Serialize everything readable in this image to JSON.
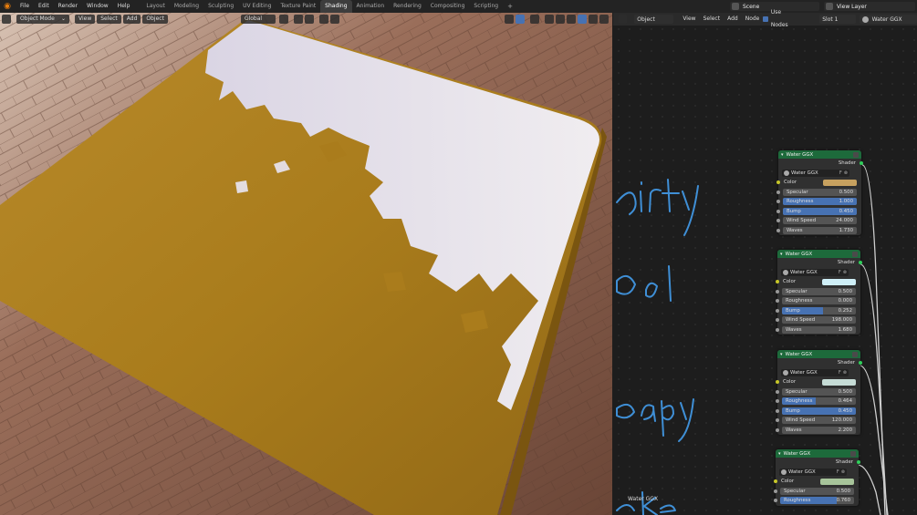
{
  "topbar": {
    "menus": [
      "File",
      "Edit",
      "Render",
      "Window",
      "Help"
    ],
    "workspaces": [
      {
        "label": "Layout",
        "active": false
      },
      {
        "label": "Modeling",
        "active": false
      },
      {
        "label": "Sculpting",
        "active": false
      },
      {
        "label": "UV Editing",
        "active": false
      },
      {
        "label": "Texture Paint",
        "active": false
      },
      {
        "label": "Shading",
        "active": true
      },
      {
        "label": "Animation",
        "active": false
      },
      {
        "label": "Rendering",
        "active": false
      },
      {
        "label": "Compositing",
        "active": false
      },
      {
        "label": "Scripting",
        "active": false
      }
    ],
    "add_workspace": "+",
    "scene": "Scene",
    "view_layer": "View Layer"
  },
  "viewport": {
    "mode": "Object Mode",
    "menus": [
      "View",
      "Select",
      "Add",
      "Object"
    ],
    "transform_orientation": "Global"
  },
  "node_editor": {
    "object_type": "Object",
    "menus": [
      "View",
      "Select",
      "Add",
      "Node"
    ],
    "use_nodes_label": "Use Nodes",
    "use_nodes_checked": true,
    "slot": "Slot 1",
    "material": "Water GGX",
    "handwritten_labels": [
      "dirty",
      "pool",
      "soapy",
      "lake"
    ],
    "frame_label": "Water GGX",
    "nodes": [
      {
        "title": "Water GGX",
        "output": "Shader",
        "group": "Water GGX",
        "fake_user": "F",
        "color": "#c7a15f",
        "fields": [
          {
            "label": "Specular",
            "value": "0.500",
            "fill": 0
          },
          {
            "label": "Roughness",
            "value": "1.000",
            "fill": 1
          },
          {
            "label": "Bump",
            "value": "0.450",
            "fill": 1
          },
          {
            "label": "Wind Speed",
            "value": "24.000",
            "fill": 0
          },
          {
            "label": "Waves",
            "value": "1.730",
            "fill": 0
          }
        ]
      },
      {
        "title": "Water GGX",
        "output": "Shader",
        "group": "Water GGX",
        "fake_user": "F",
        "color": "#cfeff7",
        "fields": [
          {
            "label": "Specular",
            "value": "0.500",
            "fill": 0
          },
          {
            "label": "Roughness",
            "value": "0.000",
            "fill": 0
          },
          {
            "label": "Bump",
            "value": "0.252",
            "fill": 0.55
          },
          {
            "label": "Wind Speed",
            "value": "198.000",
            "fill": 0
          },
          {
            "label": "Waves",
            "value": "1.680",
            "fill": 0
          }
        ]
      },
      {
        "title": "Water GGX",
        "output": "Shader",
        "group": "Water GGX",
        "fake_user": "F",
        "color": "#c6dcd6",
        "fields": [
          {
            "label": "Specular",
            "value": "0.500",
            "fill": 0
          },
          {
            "label": "Roughness",
            "value": "0.464",
            "fill": 0.46
          },
          {
            "label": "Bump",
            "value": "0.450",
            "fill": 1
          },
          {
            "label": "Wind Speed",
            "value": "120.000",
            "fill": 0
          },
          {
            "label": "Waves",
            "value": "2.200",
            "fill": 0
          }
        ]
      },
      {
        "title": "Water GGX",
        "output": "Shader",
        "group": "Water GGX",
        "fake_user": "F",
        "color": "#a7c49a",
        "fields": [
          {
            "label": "Specular",
            "value": "0.500",
            "fill": 0
          },
          {
            "label": "Roughness",
            "value": "0.760",
            "fill": 0.76
          }
        ]
      }
    ]
  }
}
